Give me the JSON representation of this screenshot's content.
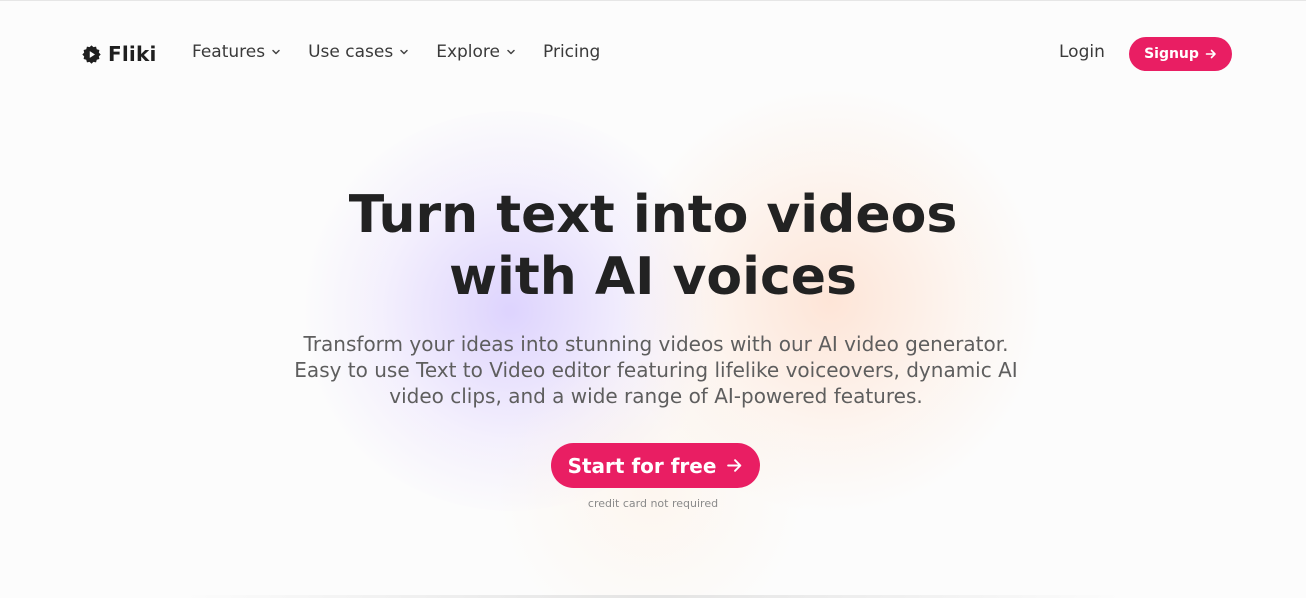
{
  "brand": {
    "name": "Fliki",
    "accent_color": "#e91e63"
  },
  "nav": {
    "items": [
      {
        "label": "Features",
        "has_dropdown": true,
        "icon": "chevron-down-icon"
      },
      {
        "label": "Use cases",
        "has_dropdown": true,
        "icon": "chevron-down-icon"
      },
      {
        "label": "Explore",
        "has_dropdown": true,
        "icon": "chevron-down-icon"
      },
      {
        "label": "Pricing",
        "has_dropdown": false
      }
    ],
    "login_label": "Login",
    "signup_label": "Signup",
    "signup_icon": "arrow-right-icon"
  },
  "hero": {
    "title_lines": [
      "Turn text into videos",
      "with AI voices"
    ],
    "subtitle_lines": [
      "Transform your ideas into stunning videos with our AI video generator.",
      "Easy to use Text to Video editor featuring lifelike voiceovers, dynamic AI",
      "video clips, and a wide range of AI-powered features."
    ],
    "cta_label": "Start for free",
    "cta_icon": "arrow-right-icon",
    "cta_note": "credit card not required"
  }
}
